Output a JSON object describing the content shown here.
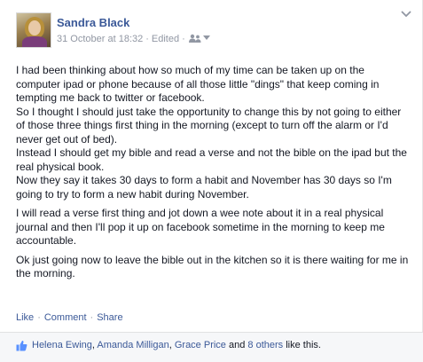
{
  "post": {
    "author": "Sandra Black",
    "timestamp": "31 October at 18:32",
    "edited_label": "Edited",
    "audience_icon": "friends-icon",
    "paragraphs": [
      "I had been thinking about how so much of my time can be taken up on the computer ipad or phone because of all those little \"dings\" that keep coming in tempting me back to twitter or facebook.",
      "So I thought I should just take the opportunity to change this by not going to either of those three things first thing in the morning (except to turn off the alarm or I'd never get out of bed).",
      "Instead I should get my bible and read a verse and not the bible on the ipad but the real physical book.",
      "Now they say it takes 30 days to form a habit and November has 30 days so I'm going to try to form a new habit during November.",
      "I will read a verse first thing and jot down a wee note about it in a real physical journal and then I'll pop it up on facebook sometime in the morning to keep me accountable.",
      "Ok just going now to leave the bible out in the kitchen so it is there waiting for me in the morning."
    ]
  },
  "actions": {
    "like": "Like",
    "comment": "Comment",
    "share": "Share"
  },
  "likes": {
    "names": [
      "Helena Ewing",
      "Amanda Milligan",
      "Grace Price"
    ],
    "and_text": "and",
    "others": "8 others",
    "suffix": "like this."
  },
  "colors": {
    "link": "#3b5998",
    "meta": "#9197a3",
    "text": "#141823"
  }
}
